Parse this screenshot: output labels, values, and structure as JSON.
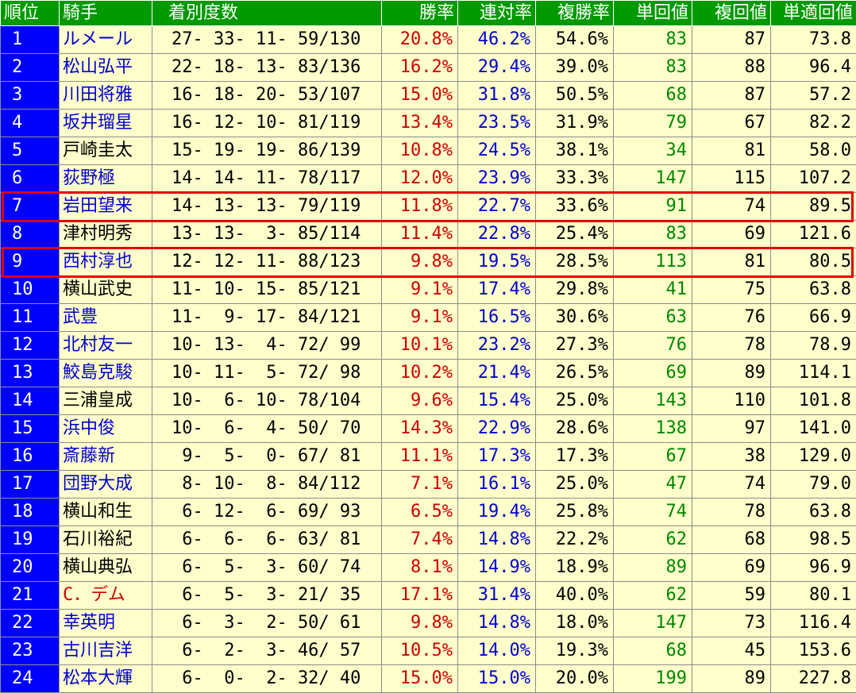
{
  "colors": {
    "header_bg": "#009900",
    "rank_bg": "#0000ff",
    "cell_bg": "#ffffcc",
    "win_rate": "#cc0000",
    "ren_rate": "#0000cc",
    "tan_value": "#008800",
    "jockey_link": "#0000cc",
    "jockey_plain": "#000000",
    "jockey_foreign": "#cc0000",
    "highlight": "#e00000"
  },
  "table": {
    "headers": [
      "順位",
      "騎手",
      "着別度数",
      "勝率",
      "連対率",
      "複勝率",
      "単回値",
      "複回値",
      "単適回値"
    ],
    "rows": [
      {
        "rank": "1",
        "jockey": "ルメール",
        "jstyle": "link",
        "record": "27- 33- 11- 59/130",
        "win": "20.8%",
        "ren": "46.2%",
        "fuk": "54.6%",
        "tan": "83",
        "fkv": "87",
        "tnt": "73.8"
      },
      {
        "rank": "2",
        "jockey": "松山弘平",
        "jstyle": "link",
        "record": "22- 18- 13- 83/136",
        "win": "16.2%",
        "ren": "29.4%",
        "fuk": "39.0%",
        "tan": "83",
        "fkv": "88",
        "tnt": "96.4"
      },
      {
        "rank": "3",
        "jockey": "川田将雅",
        "jstyle": "link",
        "record": "16- 18- 20- 53/107",
        "win": "15.0%",
        "ren": "31.8%",
        "fuk": "50.5%",
        "tan": "68",
        "fkv": "87",
        "tnt": "57.2"
      },
      {
        "rank": "4",
        "jockey": "坂井瑠星",
        "jstyle": "link",
        "record": "16- 12- 10- 81/119",
        "win": "13.4%",
        "ren": "23.5%",
        "fuk": "31.9%",
        "tan": "79",
        "fkv": "67",
        "tnt": "82.2"
      },
      {
        "rank": "5",
        "jockey": "戸崎圭太",
        "jstyle": "plain",
        "record": "15- 19- 19- 86/139",
        "win": "10.8%",
        "ren": "24.5%",
        "fuk": "38.1%",
        "tan": "34",
        "fkv": "81",
        "tnt": "58.0"
      },
      {
        "rank": "6",
        "jockey": "荻野極",
        "jstyle": "link",
        "record": "14- 14- 11- 78/117",
        "win": "12.0%",
        "ren": "23.9%",
        "fuk": "33.3%",
        "tan": "147",
        "fkv": "115",
        "tnt": "107.2"
      },
      {
        "rank": "7",
        "jockey": "岩田望来",
        "jstyle": "link",
        "record": "14- 13- 13- 79/119",
        "win": "11.8%",
        "ren": "22.7%",
        "fuk": "33.6%",
        "tan": "91",
        "fkv": "74",
        "tnt": "89.5"
      },
      {
        "rank": "8",
        "jockey": "津村明秀",
        "jstyle": "plain",
        "record": "13- 13-  3- 85/114",
        "win": "11.4%",
        "ren": "22.8%",
        "fuk": "25.4%",
        "tan": "83",
        "fkv": "69",
        "tnt": "121.6"
      },
      {
        "rank": "9",
        "jockey": "西村淳也",
        "jstyle": "link",
        "record": "12- 12- 11- 88/123",
        "win": "9.8%",
        "ren": "19.5%",
        "fuk": "28.5%",
        "tan": "113",
        "fkv": "81",
        "tnt": "80.5"
      },
      {
        "rank": "10",
        "jockey": "横山武史",
        "jstyle": "plain",
        "record": "11- 10- 15- 85/121",
        "win": "9.1%",
        "ren": "17.4%",
        "fuk": "29.8%",
        "tan": "41",
        "fkv": "75",
        "tnt": "63.8"
      },
      {
        "rank": "11",
        "jockey": "武豊",
        "jstyle": "link",
        "record": "11-  9- 17- 84/121",
        "win": "9.1%",
        "ren": "16.5%",
        "fuk": "30.6%",
        "tan": "63",
        "fkv": "76",
        "tnt": "66.9"
      },
      {
        "rank": "12",
        "jockey": "北村友一",
        "jstyle": "link",
        "record": "10- 13-  4- 72/ 99",
        "win": "10.1%",
        "ren": "23.2%",
        "fuk": "27.3%",
        "tan": "76",
        "fkv": "78",
        "tnt": "78.9"
      },
      {
        "rank": "13",
        "jockey": "鮫島克駿",
        "jstyle": "link",
        "record": "10- 11-  5- 72/ 98",
        "win": "10.2%",
        "ren": "21.4%",
        "fuk": "26.5%",
        "tan": "69",
        "fkv": "89",
        "tnt": "114.1"
      },
      {
        "rank": "14",
        "jockey": "三浦皇成",
        "jstyle": "plain",
        "record": "10-  6- 10- 78/104",
        "win": "9.6%",
        "ren": "15.4%",
        "fuk": "25.0%",
        "tan": "143",
        "fkv": "110",
        "tnt": "101.8"
      },
      {
        "rank": "15",
        "jockey": "浜中俊",
        "jstyle": "link",
        "record": "10-  6-  4- 50/ 70",
        "win": "14.3%",
        "ren": "22.9%",
        "fuk": "28.6%",
        "tan": "138",
        "fkv": "97",
        "tnt": "141.0"
      },
      {
        "rank": "16",
        "jockey": "斎藤新",
        "jstyle": "link",
        "record": " 9-  5-  0- 67/ 81",
        "win": "11.1%",
        "ren": "17.3%",
        "fuk": "17.3%",
        "tan": "67",
        "fkv": "38",
        "tnt": "129.0"
      },
      {
        "rank": "17",
        "jockey": "団野大成",
        "jstyle": "link",
        "record": " 8- 10-  8- 84/112",
        "win": "7.1%",
        "ren": "16.1%",
        "fuk": "25.0%",
        "tan": "47",
        "fkv": "74",
        "tnt": "79.0"
      },
      {
        "rank": "18",
        "jockey": "横山和生",
        "jstyle": "plain",
        "record": " 6- 12-  6- 69/ 93",
        "win": "6.5%",
        "ren": "19.4%",
        "fuk": "25.8%",
        "tan": "74",
        "fkv": "78",
        "tnt": "63.8"
      },
      {
        "rank": "19",
        "jockey": "石川裕紀",
        "jstyle": "plain",
        "record": " 6-  6-  6- 63/ 81",
        "win": "7.4%",
        "ren": "14.8%",
        "fuk": "22.2%",
        "tan": "62",
        "fkv": "68",
        "tnt": "98.5"
      },
      {
        "rank": "20",
        "jockey": "横山典弘",
        "jstyle": "plain",
        "record": " 6-  5-  3- 60/ 74",
        "win": "8.1%",
        "ren": "14.9%",
        "fuk": "18.9%",
        "tan": "89",
        "fkv": "69",
        "tnt": "96.9"
      },
      {
        "rank": "21",
        "jockey": "C．デム",
        "jstyle": "foreign",
        "record": " 6-  5-  3- 21/ 35",
        "win": "17.1%",
        "ren": "31.4%",
        "fuk": "40.0%",
        "tan": "62",
        "fkv": "59",
        "tnt": "80.1"
      },
      {
        "rank": "22",
        "jockey": "幸英明",
        "jstyle": "link",
        "record": " 6-  3-  2- 50/ 61",
        "win": "9.8%",
        "ren": "14.8%",
        "fuk": "18.0%",
        "tan": "147",
        "fkv": "73",
        "tnt": "116.4"
      },
      {
        "rank": "23",
        "jockey": "古川吉洋",
        "jstyle": "link",
        "record": " 6-  2-  3- 46/ 57",
        "win": "10.5%",
        "ren": "14.0%",
        "fuk": "19.3%",
        "tan": "68",
        "fkv": "45",
        "tnt": "153.6"
      },
      {
        "rank": "24",
        "jockey": "松本大輝",
        "jstyle": "link",
        "record": " 6-  0-  2- 32/ 40",
        "win": "15.0%",
        "ren": "15.0%",
        "fuk": "20.0%",
        "tan": "199",
        "fkv": "89",
        "tnt": "227.8"
      }
    ]
  },
  "highlighted_ranks": [
    "7",
    "9"
  ]
}
